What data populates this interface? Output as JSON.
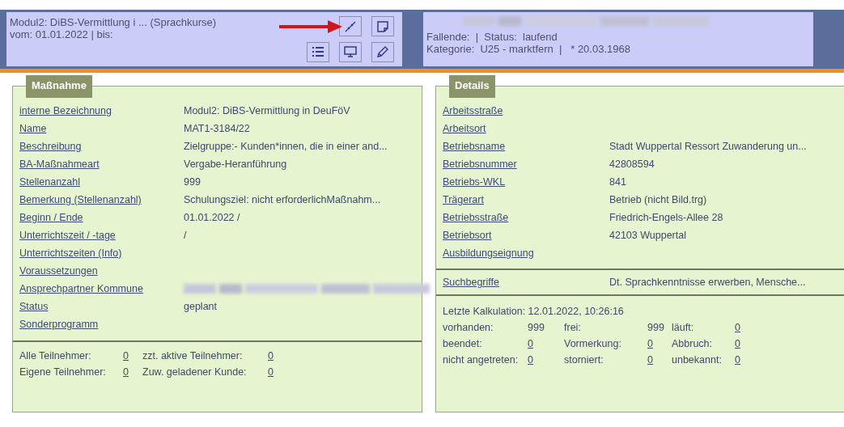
{
  "header": {
    "course_title": "Modul2: DiBS-Vermittlung i ...",
    "course_category": "(Sprachkurse)",
    "date_line": "vom: 01.01.2022 | bis:"
  },
  "person": {
    "name_redacted": true,
    "lines": [
      "Fallende:  |  Status:  laufend",
      "Kategorie:  U25 - marktfern  |   * 20.03.1968"
    ]
  },
  "massnahme": {
    "title": "Maßnahme",
    "rows": [
      {
        "label": "interne Bezeichnung",
        "value": "Modul2: DiBS-Vermittlung in DeuFöV",
        "redacted": false
      },
      {
        "label": "Name",
        "value": "MAT1-3184/22",
        "redacted": false
      },
      {
        "label": "Beschreibung",
        "value": "Zielgruppe:- Kunden*innen, die in einer and...",
        "redacted": false
      },
      {
        "label": "BA-Maßnahmeart",
        "value": "Vergabe-Heranführung",
        "redacted": false
      },
      {
        "label": "Stellenanzahl",
        "value": "999",
        "redacted": false
      },
      {
        "label": "Bemerkung (Stellenanzahl)",
        "value": "Schulungsziel: nicht erforderlichMaßnahm...",
        "redacted": false
      },
      {
        "label": "Beginn / Ende",
        "value": "01.01.2022 /",
        "redacted": false
      },
      {
        "label": "Unterrichtszeit / -tage",
        "value": "/",
        "redacted": false
      },
      {
        "label": "Unterrichtszeiten (Info)",
        "redacted": false
      },
      {
        "label": "Voraussetzungen",
        "redacted": false
      },
      {
        "label": "Ansprechpartner Kommune",
        "redacted": true
      },
      {
        "label": "Status",
        "value": "geplant",
        "redacted": false
      },
      {
        "label": "Sonderprogramm",
        "redacted": false
      }
    ],
    "counts": [
      {
        "label": "Alle Teilnehmer:",
        "value": "0"
      },
      {
        "label": "zzt. aktive Teilnehmer:",
        "value": "0"
      },
      {
        "label": "Eigene Teilnehmer:",
        "value": "0"
      },
      {
        "label": "Zuw. geladener Kunde:",
        "value": "0"
      }
    ]
  },
  "details": {
    "title": "Details",
    "rows": [
      {
        "label": "Arbeitsstraße"
      },
      {
        "label": "Arbeitsort"
      },
      {
        "label": "Betriebsname",
        "value": "Stadt Wuppertal Ressort Zuwanderung un..."
      },
      {
        "label": "Betriebsnummer",
        "value": "42808594"
      },
      {
        "label": "Betriebs-WKL",
        "value": "841"
      },
      {
        "label": "Trägerart",
        "value": "Betrieb (nicht Bild.trg)"
      },
      {
        "label": "Betriebsstraße",
        "value": "Friedrich-Engels-Allee 28"
      },
      {
        "label": "Betriebsort",
        "value": "42103 Wuppertal"
      },
      {
        "label": "Ausbildungseignung"
      }
    ],
    "search": {
      "label": "Suchbegriffe",
      "value": "Dt. Sprachkenntnisse erwerben, Mensche..."
    },
    "calculation": "Letzte Kalkulation: 12.01.2022, 10:26:16",
    "stats": [
      {
        "label": "vorhanden:",
        "value": "999",
        "linked": false
      },
      {
        "label": "frei:",
        "value": "999",
        "linked": false
      },
      {
        "label": "läuft:",
        "value": "0",
        "linked": true
      },
      {
        "label": "beendet:",
        "value": "0",
        "linked": true
      },
      {
        "label": "Vormerkung:",
        "value": "0",
        "linked": true
      },
      {
        "label": "Abbruch:",
        "value": "0",
        "linked": true
      },
      {
        "label": "nicht angetreten:",
        "value": "0",
        "linked": true
      },
      {
        "label": "storniert:",
        "value": "0",
        "linked": true
      },
      {
        "label": "unbekannt:",
        "value": "0",
        "linked": true
      }
    ]
  }
}
